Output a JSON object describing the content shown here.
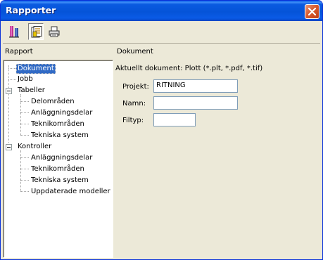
{
  "window": {
    "title": "Rapporter"
  },
  "toolbar": {
    "buttons": [
      {
        "name": "report-tool-icon"
      },
      {
        "name": "document-list-icon"
      },
      {
        "name": "print-icon"
      }
    ]
  },
  "headers": {
    "left": "Rapport",
    "right": "Dokument"
  },
  "tree": {
    "items": [
      {
        "label": "Dokument"
      },
      {
        "label": "Jobb"
      },
      {
        "label": "Tabeller"
      },
      {
        "label": "Delområden"
      },
      {
        "label": "Anläggningsdelar"
      },
      {
        "label": "Teknikområden"
      },
      {
        "label": "Tekniska system"
      },
      {
        "label": "Kontroller"
      },
      {
        "label": "Anläggningsdelar"
      },
      {
        "label": "Teknikområden"
      },
      {
        "label": "Tekniska system"
      },
      {
        "label": "Uppdaterade modeller"
      }
    ],
    "selected": "Dokument"
  },
  "panel": {
    "current_document": "Aktuellt dokument: Plott (*.plt, *.pdf, *.tif)",
    "fields": [
      {
        "label": "Projekt:",
        "value": ""
      },
      {
        "label": "Namn:",
        "value": ""
      },
      {
        "label": "Filtyp:",
        "value": ""
      }
    ],
    "project_value": "RITNING"
  }
}
